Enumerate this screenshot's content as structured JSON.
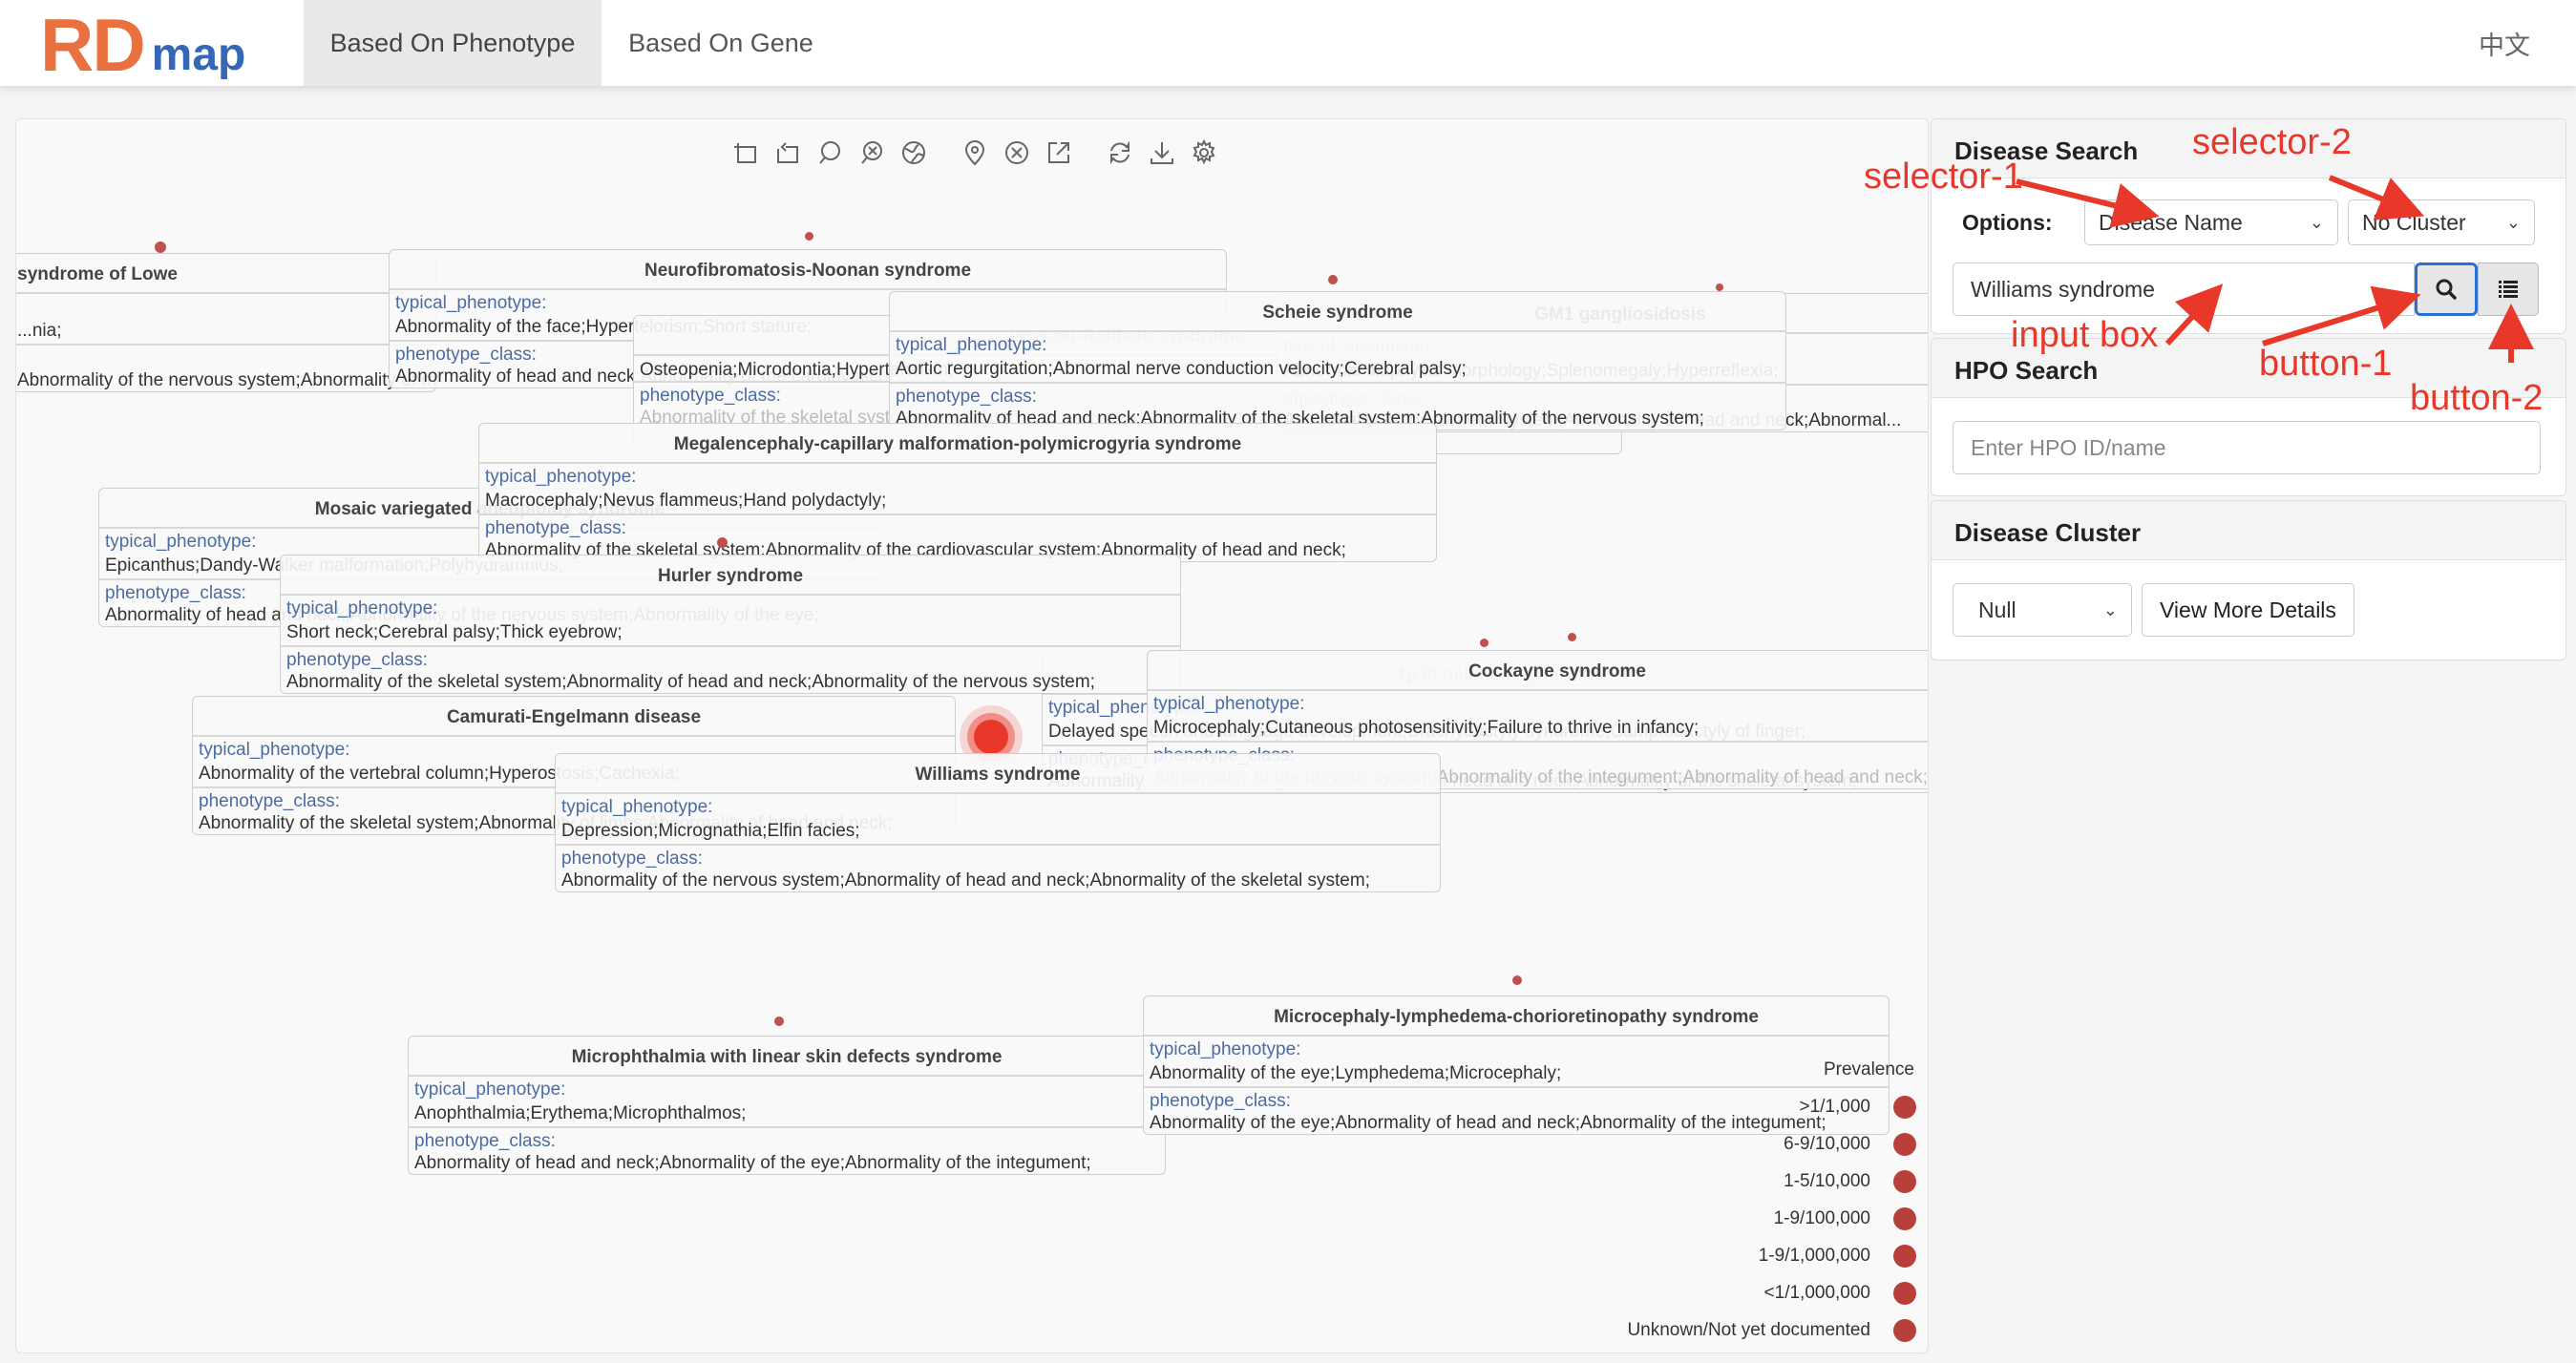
{
  "header": {
    "logo_rd": "RD",
    "logo_map": "map",
    "tabs": [
      {
        "label": "Based On Phenotype",
        "active": true
      },
      {
        "label": "Based On Gene",
        "active": false
      }
    ],
    "language": "中文"
  },
  "toolbar": {
    "icons": [
      "zoom-area-icon",
      "zoom-reset-icon",
      "lasso-icon",
      "clear-selection-icon",
      "globe-icon",
      "pin-icon",
      "close-circle-icon",
      "export-icon",
      "refresh-icon",
      "download-icon",
      "settings-icon"
    ]
  },
  "labels": {
    "typical_phenotype": "typical_phenotype:",
    "phenotype_class": "phenotype_class:"
  },
  "cards": [
    {
      "title": "Oculocerebrorenal syndrome of Lowe",
      "typical": "...nia;",
      "class": "Abnormality of the nervous system;Abnormality of metabolism/homeostasis;"
    },
    {
      "title": "Neurofibromatosis-Noonan syndrome",
      "typical": "Abnormality of the face;Hypertelorism;Short stature;",
      "class": "Abnormality of head and neck;Abnormality of the cardiovascular system;Abnormality of the ear;"
    },
    {
      "title": "Wolcott-Rallison syndrome",
      "typical": "Osteopenia;Microdontia;Hypertelorism;",
      "class": "Abnormality of the skeletal system;Abnormality of the digestive system;Abnormality of metabolism/homeostasis;"
    },
    {
      "title": "Scheie syndrome",
      "typical": "Aortic regurgitation;Abnormal nerve conduction velocity;Cerebral palsy;",
      "class": "Abnormality of head and neck;Abnormality of the skeletal system;Abnormality of the nervous system;"
    },
    {
      "title": "GM1 gangliosidosis",
      "typical": "Abnormal diaphysis morphology;Splenomegaly;Hyperreflexia;",
      "class": "Abnormality of the skeletal system;Abnormality of head and neck;Abnormal..."
    },
    {
      "title": "Megalencephaly-capillary malformation-polymicrogyria syndrome",
      "typical": "Macrocephaly;Nevus flammeus;Hand polydactyly;",
      "class": "Abnormality of the skeletal system;Abnormality of the cardiovascular system;Abnormality of head and neck;"
    },
    {
      "title": "Mosaic variegated aneuploidy syndrome",
      "typical": "Epicanthus;Dandy-Walker malformation;Polyhydramnios;",
      "class": "Abnormality of head and neck;Abnormality of the nervous system;Abnormality of the eye;"
    },
    {
      "title": "Hurler syndrome",
      "typical": "Short neck;Cerebral palsy;Thick eyebrow;",
      "class": "Abnormality of the skeletal system;Abnormality of head and neck;Abnormality of the nervous system;"
    },
    {
      "title": "1p36 deletion syndrome",
      "typical": "Delayed speech and language development;Brachydactyly syndrome;Camptodactyly of finger;",
      "class": "Abnormality of the nervous system;Abnormality of head and neck;Abnormality of the skeletal system;"
    },
    {
      "title": "Cockayne syndrome",
      "typical": "Microcephaly;Cutaneous photosensitivity;Failure to thrive in infancy;",
      "class": "Abnormality of the nervous system;Abnormality of the integument;Abnormality of head and neck;"
    },
    {
      "title": "Camurati-Engelmann disease",
      "typical": "Abnormality of the vertebral column;Hyperostosis;Cachexia;",
      "class": "Abnormality of the skeletal system;Abnormality of limbs;Abnormality of head and neck;"
    },
    {
      "title": "Williams syndrome",
      "typical": "Depression;Micrognathia;Elfin facies;",
      "class": "Abnormality of the nervous system;Abnormality of head and neck;Abnormality of the skeletal system;"
    },
    {
      "title": "Microphthalmia with linear skin defects syndrome",
      "typical": "Anophthalmia;Erythema;Microphthalmos;",
      "class": "Abnormality of head and neck;Abnormality of the eye;Abnormality of the integument;"
    },
    {
      "title": "Microcephaly-lymphedema-chorioretinopathy syndrome",
      "typical": "Abnormality of the eye;Lymphedema;Microcephaly;",
      "class": "Abnormality of the eye;Abnormality of head and neck;Abnormality of the integument;"
    }
  ],
  "legend": {
    "title": "Prevalence",
    "items": [
      ">1/1,000",
      "6-9/10,000",
      "1-5/10,000",
      "1-9/100,000",
      "1-9/1,000,000",
      "<1/1,000,000",
      "Unknown/Not yet documented"
    ],
    "color": "#b8403b"
  },
  "disease_search": {
    "title": "Disease Search",
    "options_label": "Options:",
    "selector1_value": "Disease Name",
    "selector2_value": "No Cluster",
    "input_value": "Williams syndrome"
  },
  "hpo_search": {
    "title": "HPO Search",
    "placeholder": "Enter HPO ID/name"
  },
  "disease_cluster": {
    "title": "Disease Cluster",
    "select_value": "Null",
    "details_button": "View More Details"
  },
  "annotations": {
    "selector1": "selector-1",
    "selector2": "selector-2",
    "input_box": "input box",
    "button1": "button-1",
    "button2": "button-2"
  },
  "colors": {
    "logo_rd": "#e8713f",
    "logo_map": "#3567b5",
    "node": "#c0504d",
    "highlight": "#e8382a",
    "label_blue": "#4a6ca3",
    "annotation": "#e8382a",
    "primary_button_border": "#2c6fd1"
  }
}
